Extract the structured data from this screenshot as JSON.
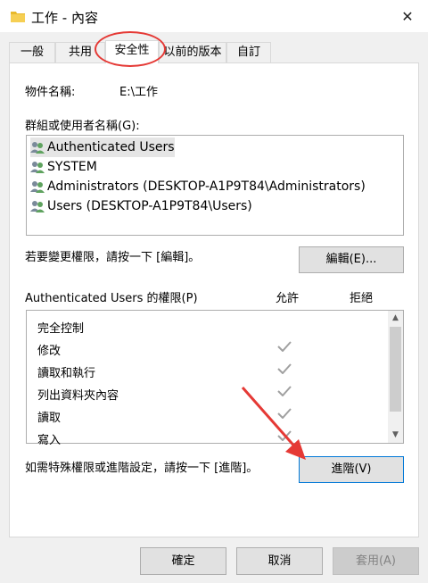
{
  "window": {
    "title": "工作 - 內容",
    "close_glyph": "✕"
  },
  "tabs": [
    {
      "label": "一般"
    },
    {
      "label": "共用"
    },
    {
      "label": "安全性"
    },
    {
      "label": "以前的版本"
    },
    {
      "label": "自訂"
    }
  ],
  "object": {
    "label": "物件名稱:",
    "value": "E:\\工作"
  },
  "groups": {
    "label": "群組或使用者名稱(G):",
    "items": [
      {
        "name": "Authenticated Users"
      },
      {
        "name": "SYSTEM"
      },
      {
        "name": "Administrators (DESKTOP-A1P9T84\\Administrators)"
      },
      {
        "name": "Users (DESKTOP-A1P9T84\\Users)"
      }
    ]
  },
  "edit": {
    "hint": "若要變更權限，請按一下 [編輯]。",
    "button": "編輯(E)..."
  },
  "permissions": {
    "title": "Authenticated Users 的權限(P)",
    "allow_header": "允許",
    "deny_header": "拒絕",
    "rows": [
      {
        "name": "完全控制",
        "allow": false
      },
      {
        "name": "修改",
        "allow": true
      },
      {
        "name": "讀取和執行",
        "allow": true
      },
      {
        "name": "列出資料夾內容",
        "allow": true
      },
      {
        "name": "讀取",
        "allow": true
      },
      {
        "name": "寫入",
        "allow": true
      }
    ]
  },
  "advanced": {
    "hint": "如需特殊權限或進階設定，請按一下 [進階]。",
    "button": "進階(V)"
  },
  "footer": {
    "ok": "確定",
    "cancel": "取消",
    "apply": "套用(A)"
  },
  "colors": {
    "annotation_red": "#e53935",
    "accent": "#0078d7"
  }
}
